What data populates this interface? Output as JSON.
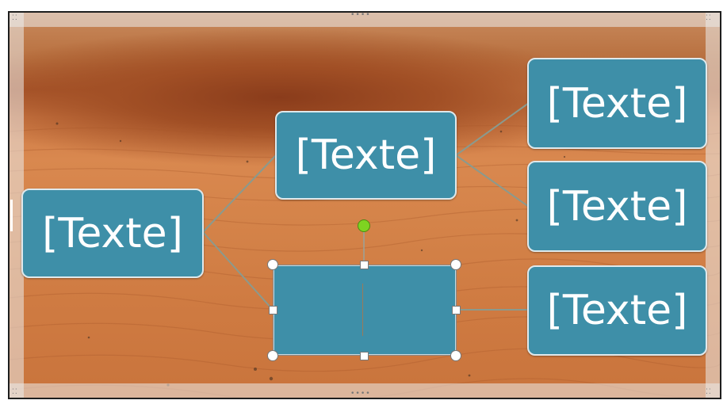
{
  "diagram": {
    "nodes": [
      {
        "id": "root",
        "label": "[Texte]"
      },
      {
        "id": "mid-top",
        "label": "[Texte]"
      },
      {
        "id": "leaf-1",
        "label": "[Texte]"
      },
      {
        "id": "leaf-2",
        "label": "[Texte]"
      },
      {
        "id": "leaf-3",
        "label": "[Texte]"
      },
      {
        "id": "selected",
        "label": ""
      }
    ],
    "node_color": "#3e8fa8",
    "connector_color": "#8a9a8e",
    "rotate_handle_color": "#7ed321"
  },
  "slide": {
    "background": "desert-photo",
    "resize_grip_icons": [
      "grip-dots-icon",
      "grip-dots-icon"
    ]
  }
}
